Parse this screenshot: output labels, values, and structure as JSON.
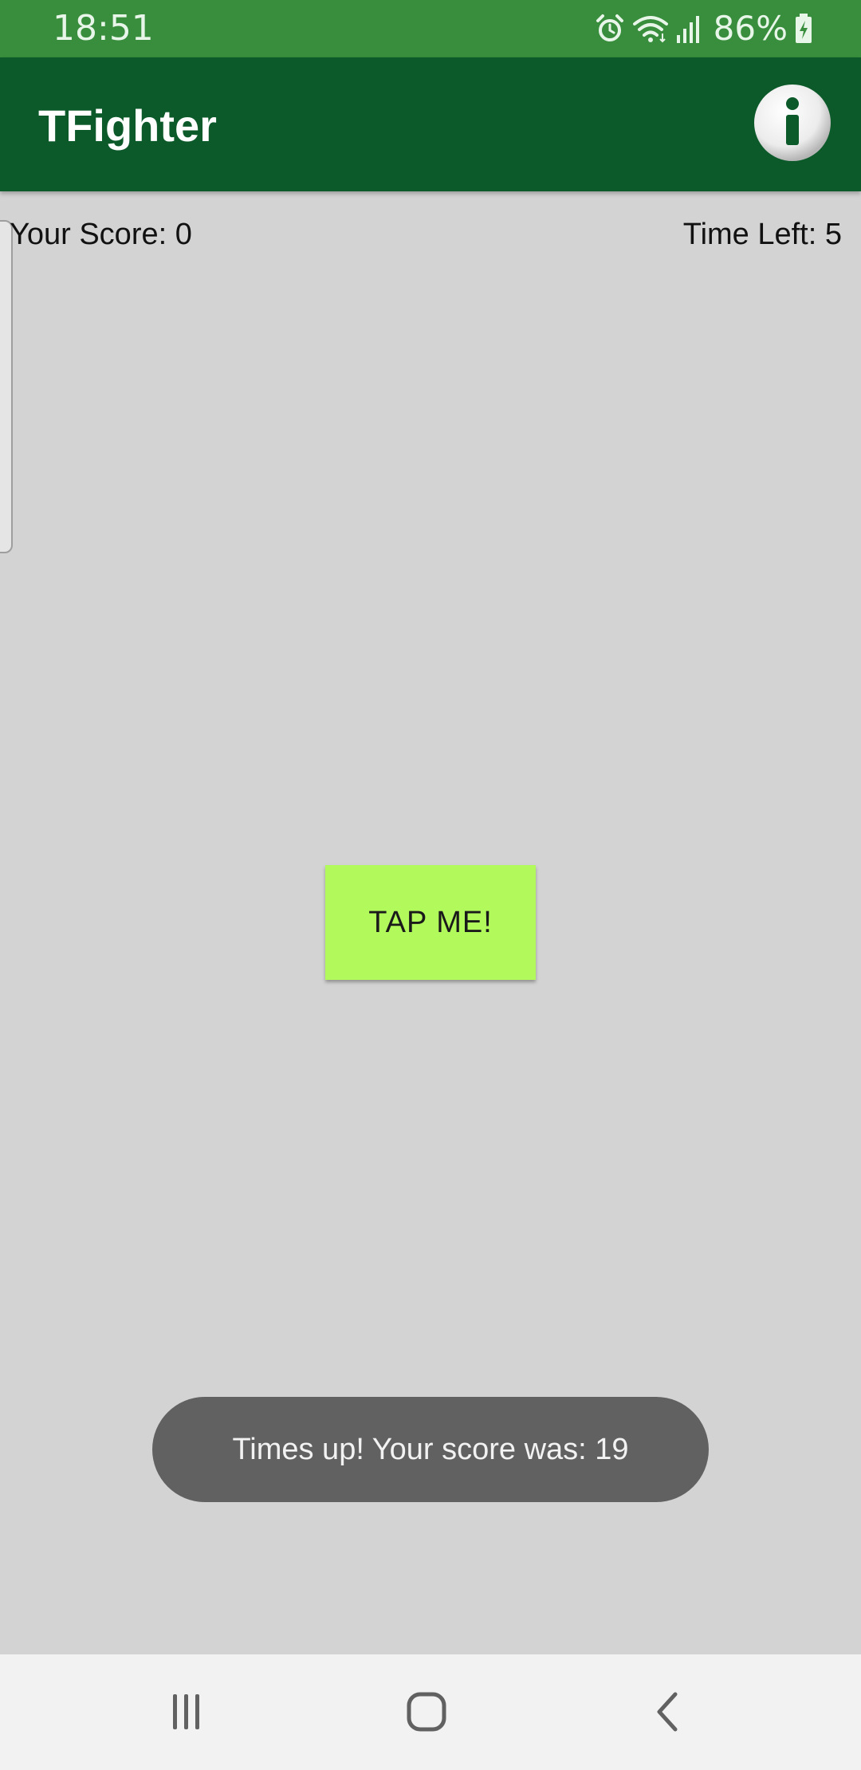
{
  "status_bar": {
    "time": "18:51",
    "battery_percent": "86%",
    "icons": [
      "alarm-icon",
      "wifi-icon",
      "signal-icon",
      "battery-charging-icon"
    ],
    "background_color": "#388e3c"
  },
  "app_bar": {
    "title": "TFighter",
    "info_icon": "info-icon",
    "background_color": "#0c5a2a"
  },
  "game": {
    "score_label": "Your Score: 0",
    "time_left_label": "Time Left: 5",
    "tap_button_label": "TAP ME!",
    "tap_button_color": "#b2fa5c",
    "background_color": "#d3d3d3"
  },
  "toast": {
    "message": "Times up! Your score was: 19"
  },
  "nav_bar": {
    "buttons": [
      "recents-icon",
      "home-icon",
      "back-icon"
    ]
  }
}
